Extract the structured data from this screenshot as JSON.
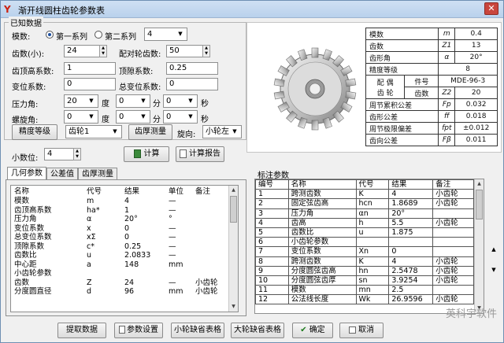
{
  "window": {
    "title": "渐开线圆柱齿轮参数表",
    "close_glyph": "✕"
  },
  "known": {
    "group_title": "已知数据",
    "module_label": "模数:",
    "series1": "第一系列",
    "series2": "第二系列",
    "module_value": "4",
    "teeth_small_label": "齿数(小):",
    "teeth_small_value": "24",
    "mating_teeth_label": "配对轮齿数:",
    "mating_teeth_value": "50",
    "addendum_coef_label": "齿顶高系数:",
    "addendum_coef_value": "1",
    "clearance_coef_label": "顶隙系数:",
    "clearance_coef_value": "0.25",
    "shift_coef_label": "变位系数:",
    "shift_coef_value": "0",
    "total_shift_label": "总变位系数:",
    "total_shift_value": "0",
    "pressure_label": "压力角:",
    "pressure_deg": "20",
    "pressure_min": "0",
    "pressure_sec": "0",
    "helix_label": "螺旋角:",
    "helix_deg": "0",
    "helix_min": "0",
    "helix_sec": "0",
    "unit_deg": "度",
    "unit_min": "分",
    "unit_sec": "秒",
    "precision_button": "精度等级",
    "precision_value": "齿轮1",
    "tooth_thickness_button": "齿厚测量",
    "rotation_label": "旋向:",
    "rotation_value": "小轮左",
    "decimals_label": "小数位:",
    "decimals_value": "4",
    "calc_button": "计算",
    "report_button": "计算报告"
  },
  "spec": {
    "rows": [
      {
        "name": "模数",
        "sym": "m",
        "val": "0.4"
      },
      {
        "name": "齿数",
        "sym": "Z1",
        "val": "13"
      },
      {
        "name": "齿形角",
        "sym": "α",
        "val": "20°"
      },
      {
        "name": "精度等级",
        "sym": "",
        "val": "8"
      },
      {
        "name": "件号",
        "sym": "",
        "val": "MDE-96-3"
      },
      {
        "name": "齿数",
        "sym": "Z2",
        "val": "20"
      },
      {
        "name": "周节累积公差",
        "sym": "Fp",
        "val": "0.032"
      },
      {
        "name": "齿形公差",
        "sym": "ff",
        "val": "0.018"
      },
      {
        "name": "周节极限偏差",
        "sym": "fpt",
        "val": "±0.012"
      },
      {
        "name": "齿向公差",
        "sym": "Fβ",
        "val": "0.011"
      }
    ],
    "pair_label_1": "配 偶",
    "pair_label_2": "齿 轮"
  },
  "tabs": [
    "几何参数",
    "公差值",
    "齿厚测量"
  ],
  "geom": {
    "headers": [
      "名称",
      "代号",
      "结果",
      "单位",
      "备注"
    ],
    "rows": [
      [
        "模数",
        "m",
        "4",
        "—",
        ""
      ],
      [
        "齿顶高系数",
        "ha*",
        "1",
        "—",
        ""
      ],
      [
        "压力角",
        "α",
        "20°",
        "°",
        ""
      ],
      [
        "变位系数",
        "x",
        "0",
        "—",
        ""
      ],
      [
        "总变位系数",
        "xΣ",
        "0",
        "—",
        ""
      ],
      [
        "顶隙系数",
        "c*",
        "0.25",
        "—",
        ""
      ],
      [
        "齿数比",
        "u",
        "2.0833",
        "—",
        ""
      ],
      [
        "中心距",
        "a",
        "148",
        "mm",
        ""
      ],
      [
        "小齿轮参数",
        "",
        "",
        "",
        ""
      ],
      [
        "齿数",
        "Z",
        "24",
        "—",
        "小齿轮"
      ],
      [
        "分度圆直径",
        "d",
        "96",
        "mm",
        "小齿轮"
      ]
    ]
  },
  "note": {
    "title": "标注参数",
    "headers": [
      "编号",
      "名称",
      "代号",
      "结果",
      "备注"
    ],
    "rows": [
      [
        "1",
        "跨测齿数",
        "K",
        "4",
        "小齿轮"
      ],
      [
        "2",
        "固定弦齿高",
        "hcn",
        "1.8689",
        "小齿轮"
      ],
      [
        "3",
        "压力角",
        "αn",
        "20°",
        ""
      ],
      [
        "4",
        "齿高",
        "h",
        "5.5",
        "小齿轮"
      ],
      [
        "5",
        "齿数比",
        "u",
        "1.875",
        ""
      ],
      [
        "6",
        "小齿轮参数",
        "",
        "",
        ""
      ],
      [
        "7",
        "变位系数",
        "Xn",
        "0",
        ""
      ],
      [
        "8",
        "跨测齿数",
        "K",
        "4",
        "小齿轮"
      ],
      [
        "9",
        "分度圆弦齿高",
        "hn",
        "2.5478",
        "小齿轮"
      ],
      [
        "10",
        "分度圆弦齿厚",
        "sn",
        "3.9254",
        "小齿轮"
      ],
      [
        "11",
        "模数",
        "mn",
        "2.5",
        ""
      ],
      [
        "12",
        "公法线长度",
        "Wk",
        "26.9596",
        "小齿轮"
      ]
    ]
  },
  "bottom": {
    "fetch": "提取数据",
    "settings": "参数设置",
    "small_table": "小轮缺省表格",
    "big_table": "大轮缺省表格",
    "ok": "确定",
    "cancel": "取消"
  },
  "watermark": "英科宇软件"
}
